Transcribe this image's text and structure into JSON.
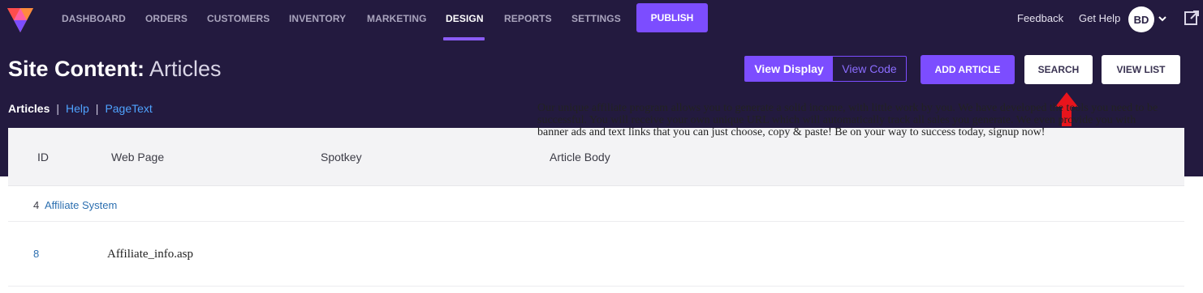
{
  "nav": {
    "items": [
      {
        "label": "DASHBOARD",
        "active": false
      },
      {
        "label": "ORDERS",
        "active": false
      },
      {
        "label": "CUSTOMERS",
        "active": false
      },
      {
        "label": "INVENTORY",
        "active": false
      },
      {
        "label": "MARKETING",
        "active": false
      },
      {
        "label": "DESIGN",
        "active": true
      },
      {
        "label": "REPORTS",
        "active": false
      },
      {
        "label": "SETTINGS",
        "active": false
      }
    ],
    "publish_label": "PUBLISH",
    "feedback_label": "Feedback",
    "help_label": "Get Help",
    "avatar_initials": "BD",
    "accent_color": "#7c4dff",
    "background_color": "#231a3f"
  },
  "header": {
    "title_bold": "Site Content:",
    "title_light": "Articles",
    "view_display_label": "View Display",
    "view_code_label": "View Code",
    "add_article_label": "ADD ARTICLE",
    "search_label": "SEARCH",
    "view_list_label": "VIEW LIST"
  },
  "subnav": {
    "current": "Articles",
    "separator": "|",
    "links": [
      "Help",
      "PageText"
    ]
  },
  "table": {
    "columns": [
      "ID",
      "Web Page",
      "Spotkey",
      "Article Body"
    ],
    "group_row": {
      "id": "4",
      "label": "Affiliate System"
    },
    "rows": [
      {
        "id": "8",
        "web_page": "Affiliate_info.asp",
        "spotkey": "",
        "body": "Our unique affiliate program allows you to generate a solid income, with little work by you. We have developed the tools you need to be successful. You will receive your own unique URL which will automatically track all sales you generate. We even provide you with banner ads and text links that you can just choose, copy & paste! Be on your way to success today, signup now!"
      }
    ]
  },
  "annotation": {
    "icon": "red-up-arrow-icon",
    "color": "#e8141c"
  }
}
